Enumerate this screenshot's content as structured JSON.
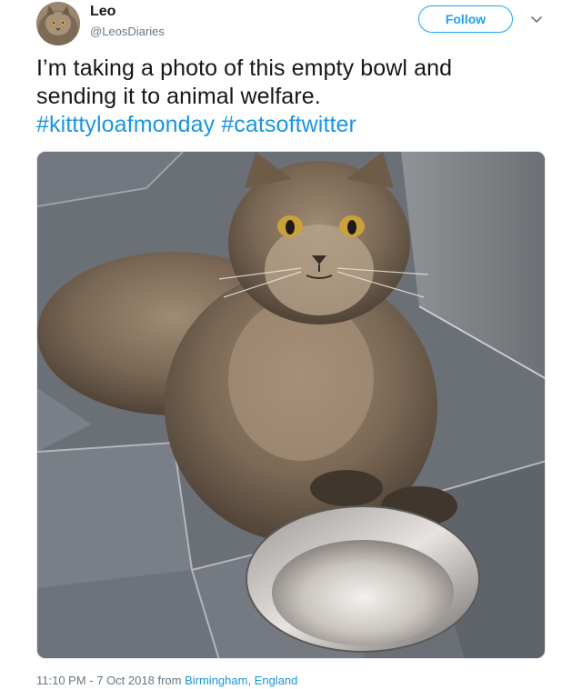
{
  "user": {
    "name": "Leo",
    "handle": "@LeosDiaries",
    "follow_label": "Follow"
  },
  "tweet": {
    "line1": "I’m taking a photo of this empty bowl and",
    "line2": "sending it to animal welfare.",
    "hashtag1": "#kitttyloafmonday",
    "hashtag2": "#catsoftwitter"
  },
  "footer": {
    "time": "11:10 PM - 7 Oct 2018",
    "from": "from",
    "location": "Birmingham, England"
  },
  "colors": {
    "link": "#1b95e0",
    "follow": "#1da1f2",
    "muted": "#657786"
  }
}
